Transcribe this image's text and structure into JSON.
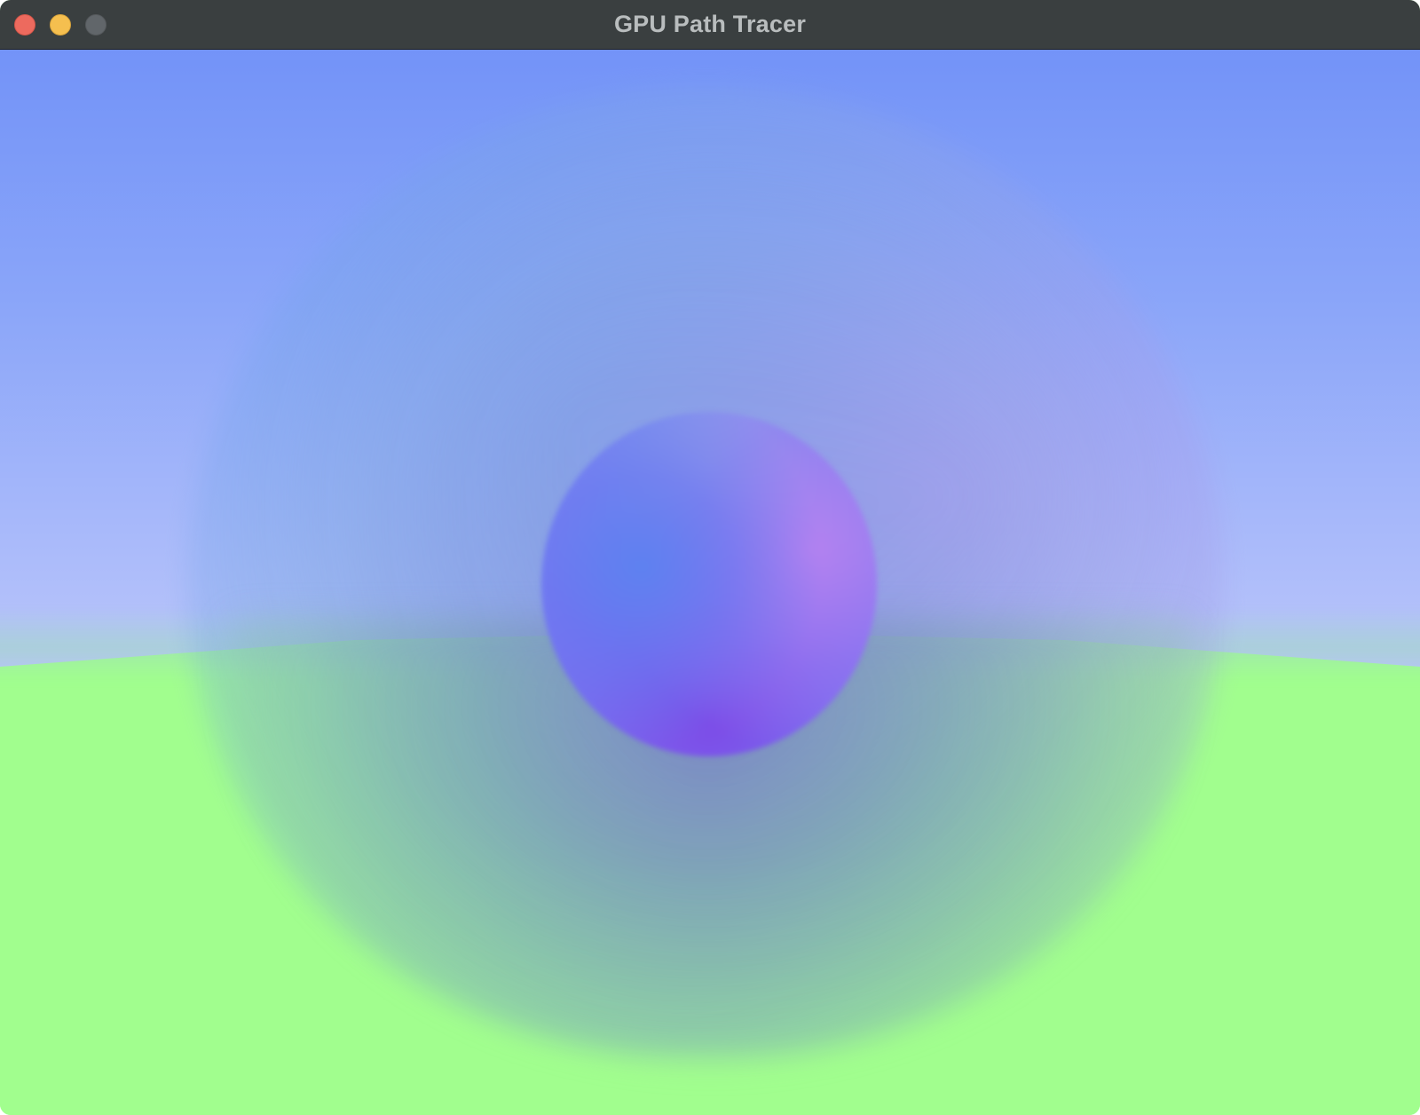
{
  "window": {
    "title": "GPU Path Tracer"
  },
  "titlebar": {
    "buttons": [
      {
        "name": "close",
        "color": "#ed6a5e"
      },
      {
        "name": "minimize",
        "color": "#f5bf4f"
      },
      {
        "name": "zoom",
        "color": "#61666a"
      }
    ]
  },
  "scene": {
    "sky_color_top": "#7393f8",
    "sky_color_horizon": "#b9c3fb",
    "ground_color": "#a1fe8e",
    "sphere_color": "#7c7cf2"
  }
}
